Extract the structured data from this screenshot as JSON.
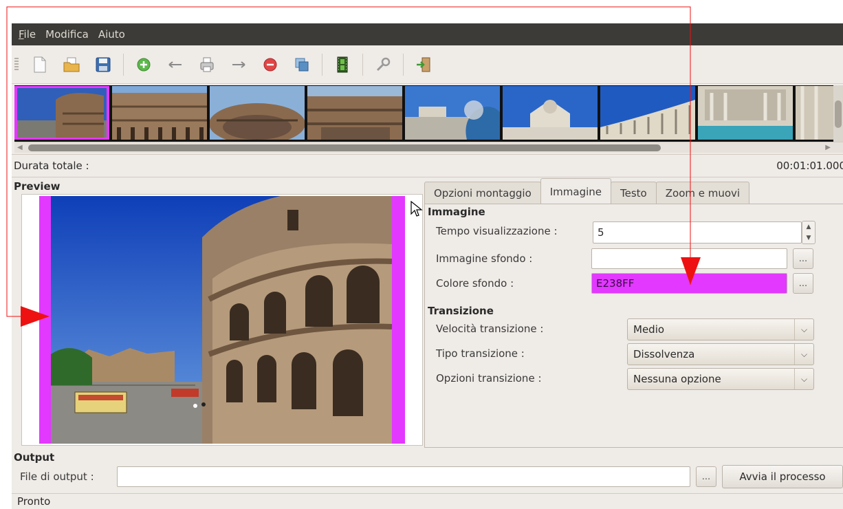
{
  "menu": {
    "items": [
      "File",
      "Modifica",
      "Aiuto"
    ]
  },
  "toolbar": {
    "buttons": [
      {
        "icon": "new-file-icon"
      },
      {
        "icon": "open-folder-icon"
      },
      {
        "icon": "save-icon"
      },
      {
        "icon": "add-icon"
      },
      {
        "icon": "arrow-left-icon"
      },
      {
        "icon": "print-icon"
      },
      {
        "icon": "arrow-right-icon"
      },
      {
        "icon": "remove-icon"
      },
      {
        "icon": "copy-icon"
      },
      {
        "icon": "film-icon"
      },
      {
        "icon": "wrench-icon"
      },
      {
        "icon": "exit-icon"
      }
    ]
  },
  "duration": {
    "label": "Durata totale :",
    "value": "00:01:01.000"
  },
  "preview": {
    "title": "Preview"
  },
  "tabs": [
    "Opzioni montaggio",
    "Immagine",
    "Testo",
    "Zoom e muovi"
  ],
  "image_section": {
    "title": "Immagine",
    "display_time_label": "Tempo visualizzazione :",
    "display_time_value": "5",
    "bg_image_label": "Immagine sfondo :",
    "bg_image_value": "",
    "bg_color_label": "Colore sfondo :",
    "bg_color_value": "E238FF",
    "dots": "..."
  },
  "transition_section": {
    "title": "Transizione",
    "speed_label": "Velocità transizione :",
    "speed_value": "Medio",
    "type_label": "Tipo transizione :",
    "type_value": "Dissolvenza",
    "options_label": "Opzioni transizione :",
    "options_value": "Nessuna opzione"
  },
  "output": {
    "title": "Output",
    "file_label": "File di output :",
    "file_value": "",
    "dots": "...",
    "start_button": "Avvia il processo"
  },
  "status": "Pronto",
  "colors": {
    "accent": "#e238ff",
    "annotation": "#ee1111",
    "menubar": "#3c3b37"
  }
}
